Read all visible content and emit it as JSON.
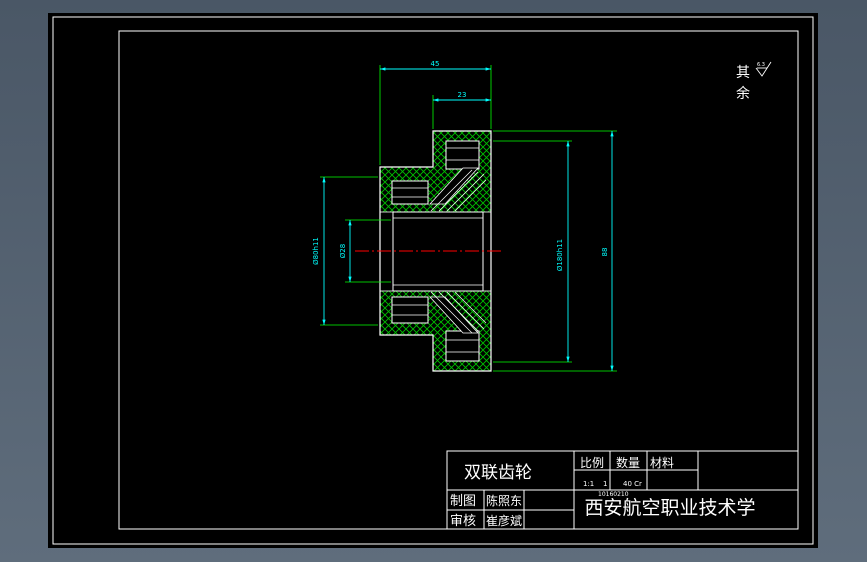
{
  "drawing": {
    "dimensions": {
      "top_overall": "45",
      "top_hub": "23",
      "left_diameter": "Ø80h11",
      "bore_diameter": "Ø28",
      "gear_diameter": "Ø180h11",
      "right_height": "88"
    },
    "surface_note": {
      "line1": "其",
      "line2": "余",
      "roughness": "6.3"
    }
  },
  "title_block": {
    "part_name": "双联齿轮",
    "headers": {
      "scale": "比例",
      "quantity": "数量",
      "material": "材料"
    },
    "values": {
      "scale": "1:1",
      "quantity": "1",
      "material": "40 Cr"
    },
    "drawn_label": "制图",
    "drawn_name": "陈照东",
    "checked_label": "审核",
    "checked_name": "崔彦斌",
    "school": "西安航空职业技术学",
    "drawing_no": "10160210"
  },
  "colors": {
    "background": "#000000",
    "border": "#ffffff",
    "outline": "#ffffff",
    "hatch": "#00c000",
    "dimension": "#00ffff",
    "extension": "#00ff00",
    "centerline": "#ff0000"
  }
}
